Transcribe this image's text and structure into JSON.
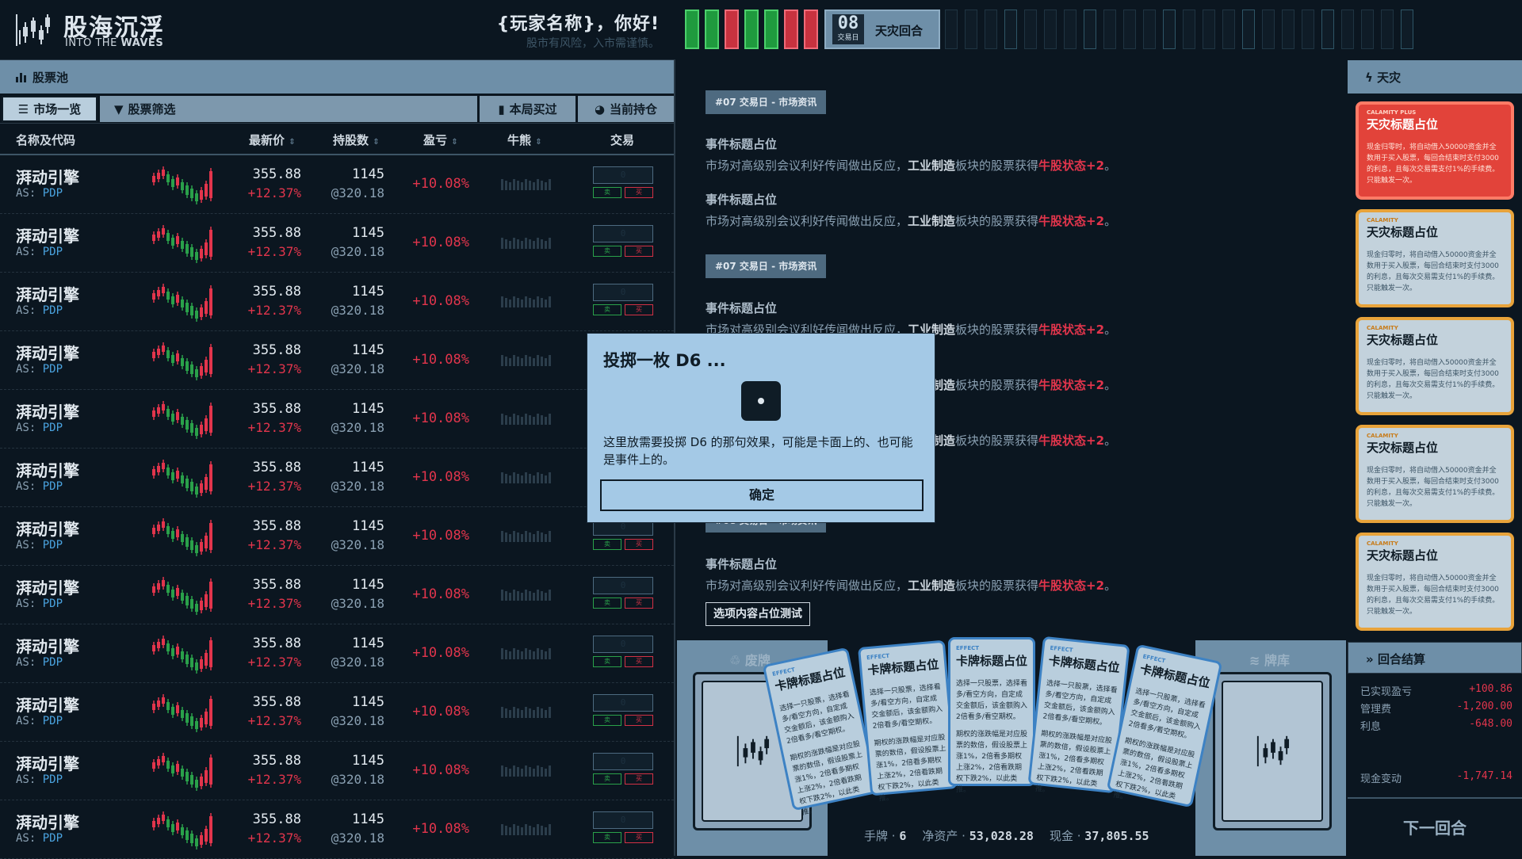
{
  "app": {
    "title_cn": "股海沉浮",
    "title_en_pre": "INTO THE ",
    "title_en_bold": "WAVES",
    "greeting": "{玩家名称}，你好!",
    "motto": "股市有风险，入市需谨慎。"
  },
  "timeline": {
    "day_num": "08",
    "day_label": "交易日",
    "round_label": "天灾回合",
    "past_days": [
      "green",
      "green",
      "red",
      "green",
      "green",
      "red",
      "red"
    ]
  },
  "pool": {
    "header": "股票池",
    "tabs": {
      "market": "市场一览",
      "filter": "股票筛选",
      "bought": "本局买过",
      "holding": "当前持仓"
    },
    "columns": {
      "name": "名称及代码",
      "price": "最新价",
      "hold": "持股数",
      "pnl": "盈亏",
      "bull": "牛熊",
      "trade": "交易"
    },
    "rows": [
      {
        "name": "湃动引擎",
        "code_pre": "AS:",
        "code": "PDP",
        "price": "355.88",
        "change": "+12.37%",
        "hold": "1145",
        "avg": "@320.18",
        "pnl": "+10.08%",
        "qty": "0",
        "sell": "卖",
        "buy": "买"
      },
      {
        "name": "湃动引擎",
        "code_pre": "AS:",
        "code": "PDP",
        "price": "355.88",
        "change": "+12.37%",
        "hold": "1145",
        "avg": "@320.18",
        "pnl": "+10.08%",
        "qty": "0",
        "sell": "卖",
        "buy": "买"
      },
      {
        "name": "湃动引擎",
        "code_pre": "AS:",
        "code": "PDP",
        "price": "355.88",
        "change": "+12.37%",
        "hold": "1145",
        "avg": "@320.18",
        "pnl": "+10.08%",
        "qty": "0",
        "sell": "卖",
        "buy": "买"
      },
      {
        "name": "湃动引擎",
        "code_pre": "AS:",
        "code": "PDP",
        "price": "355.88",
        "change": "+12.37%",
        "hold": "1145",
        "avg": "@320.18",
        "pnl": "+10.08%",
        "qty": "0",
        "sell": "卖",
        "buy": "买"
      },
      {
        "name": "湃动引擎",
        "code_pre": "AS:",
        "code": "PDP",
        "price": "355.88",
        "change": "+12.37%",
        "hold": "1145",
        "avg": "@320.18",
        "pnl": "+10.08%",
        "qty": "0",
        "sell": "卖",
        "buy": "买"
      },
      {
        "name": "湃动引擎",
        "code_pre": "AS:",
        "code": "PDP",
        "price": "355.88",
        "change": "+12.37%",
        "hold": "1145",
        "avg": "@320.18",
        "pnl": "+10.08%",
        "qty": "0",
        "sell": "卖",
        "buy": "买"
      },
      {
        "name": "湃动引擎",
        "code_pre": "AS:",
        "code": "PDP",
        "price": "355.88",
        "change": "+12.37%",
        "hold": "1145",
        "avg": "@320.18",
        "pnl": "+10.08%",
        "qty": "0",
        "sell": "卖",
        "buy": "买"
      },
      {
        "name": "湃动引擎",
        "code_pre": "AS:",
        "code": "PDP",
        "price": "355.88",
        "change": "+12.37%",
        "hold": "1145",
        "avg": "@320.18",
        "pnl": "+10.08%",
        "qty": "0",
        "sell": "卖",
        "buy": "买"
      },
      {
        "name": "湃动引擎",
        "code_pre": "AS:",
        "code": "PDP",
        "price": "355.88",
        "change": "+12.37%",
        "hold": "1145",
        "avg": "@320.18",
        "pnl": "+10.08%",
        "qty": "0",
        "sell": "卖",
        "buy": "买"
      },
      {
        "name": "湃动引擎",
        "code_pre": "AS:",
        "code": "PDP",
        "price": "355.88",
        "change": "+12.37%",
        "hold": "1145",
        "avg": "@320.18",
        "pnl": "+10.08%",
        "qty": "0",
        "sell": "卖",
        "buy": "买"
      },
      {
        "name": "湃动引擎",
        "code_pre": "AS:",
        "code": "PDP",
        "price": "355.88",
        "change": "+12.37%",
        "hold": "1145",
        "avg": "@320.18",
        "pnl": "+10.08%",
        "qty": "0",
        "sell": "卖",
        "buy": "买"
      },
      {
        "name": "湃动引擎",
        "code_pre": "AS:",
        "code": "PDP",
        "price": "355.88",
        "change": "+12.37%",
        "hold": "1145",
        "avg": "@320.18",
        "pnl": "+10.08%",
        "qty": "0",
        "sell": "卖",
        "buy": "买"
      }
    ]
  },
  "news": {
    "tag1": "#07 交易日 - 市场资讯",
    "tag2": "#07 交易日 - 市场资讯",
    "tag3": "#08 交易日 - 市场资讯",
    "event_title": "事件标题占位",
    "body_pre": "市场对高级别会议利好传闻做出反应，",
    "body_sector": "工业制造",
    "body_mid": "板块的股票获得",
    "body_effect": "牛股状态+2",
    "body_end": "。",
    "option_btn": "选项内容占位测试"
  },
  "hand": {
    "discard_label": "废牌",
    "deck_label": "牌库",
    "hand_label": "手牌",
    "hand_count": "6",
    "net_label": "净资产",
    "net_value": "53,028.28",
    "cash_label": "现金",
    "cash_value": "37,805.55",
    "card_tag": "EFFECT",
    "card_title": "卡牌标题占位",
    "card_body1": "选择一只股票，选择看多/看空方向，自定成交金额后，该金额购入2倍看多/看空期权。",
    "card_body2": "期权的涨跌幅是对应股票的数倍，假设股票上涨1%，2倍看多期权上涨2%，2倍看跌期权下跌2%，以此类推。"
  },
  "calamity": {
    "header": "天灾",
    "plus_tag": "CALAMITY PLUS",
    "tag": "CALAMITY",
    "title": "天灾标题占位",
    "body": "现金归零时，将自动借入50000资金并全数用于买入股票，每回合结束时支付3000的利息，且每次交易需支付1%的手续费。只能触发一次。"
  },
  "settle": {
    "header": "回合结算",
    "realized_label": "已实现盈亏",
    "realized_value": "+100.86",
    "fee_label": "管理费",
    "fee_value": "-1,200.00",
    "interest_label": "利息",
    "interest_value": "-648.00",
    "cash_change_label": "现金变动",
    "cash_change_value": "-1,747.14",
    "next_button": "下一回合"
  },
  "modal": {
    "title": "投掷一枚 D6 ...",
    "body": "这里放需要投掷 D6 的那句效果，可能是卡面上的、也可能是事件上的。",
    "ok": "确定"
  },
  "colors": {
    "up": "#e2354c",
    "down": "#2aa14a",
    "panel": "#6e8fa8",
    "bg": "#0b1620",
    "calamity": "#e8a33a",
    "calamity_plus": "#e2433a"
  },
  "icons": {
    "logo": "candlestick-logo-icon",
    "pool": "bar-chart-icon",
    "calamity": "lightning-icon",
    "settle": "fast-forward-icon"
  }
}
